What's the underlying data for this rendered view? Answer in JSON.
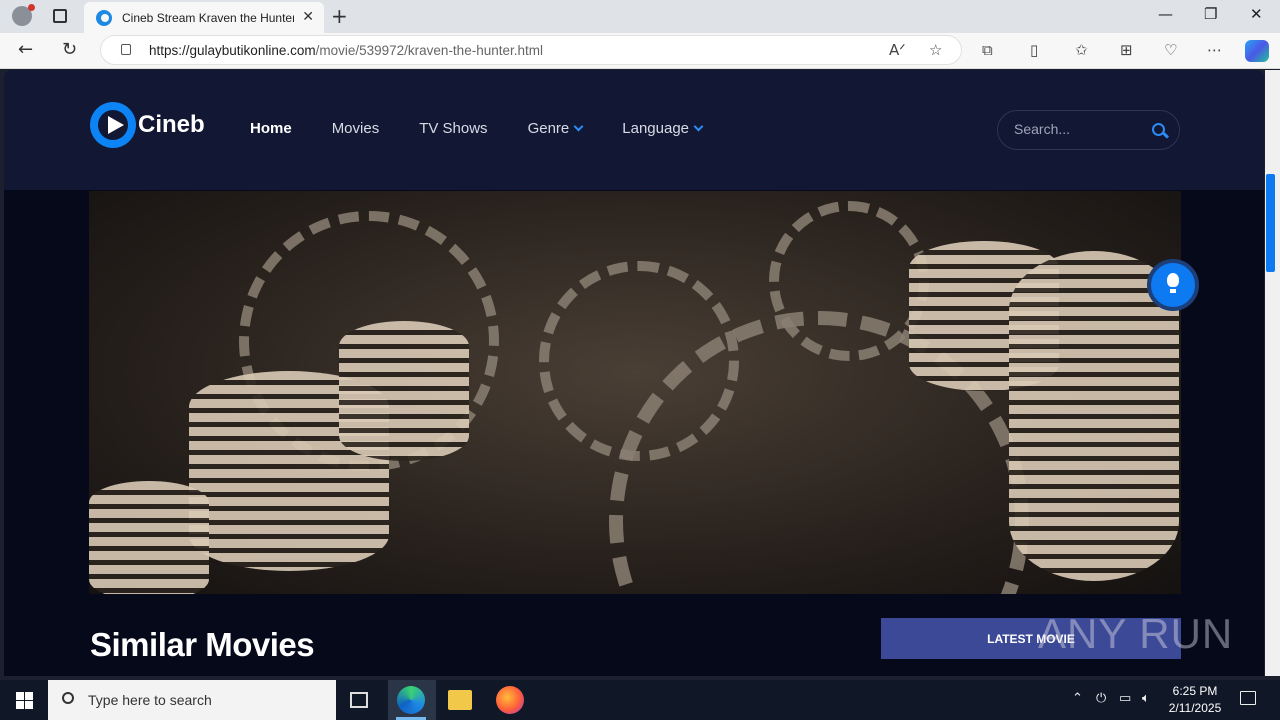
{
  "browser": {
    "tab_title": "Cineb Stream Kraven the Hunter",
    "url_domain": "https://gulaybutikonline.com",
    "url_path": "/movie/539972/kraven-the-hunter.html"
  },
  "site": {
    "logo_text": "Cineb",
    "nav": [
      {
        "label": "Home",
        "active": true
      },
      {
        "label": "Movies"
      },
      {
        "label": "TV Shows"
      },
      {
        "label": "Genre",
        "dropdown": true
      },
      {
        "label": "Language",
        "dropdown": true
      }
    ],
    "search_placeholder": "Search...",
    "section_title": "Similar Movies",
    "latest_button": "LATEST MOVIE"
  },
  "watermark": "ANY RUN",
  "taskbar": {
    "search_placeholder": "Type here to search",
    "time": "6:25 PM",
    "date": "2/11/2025"
  },
  "colors": {
    "accent": "#0d84f5",
    "header_bg": "#121833",
    "page_bg": "#05091a",
    "button_bg": "#3c4996"
  }
}
